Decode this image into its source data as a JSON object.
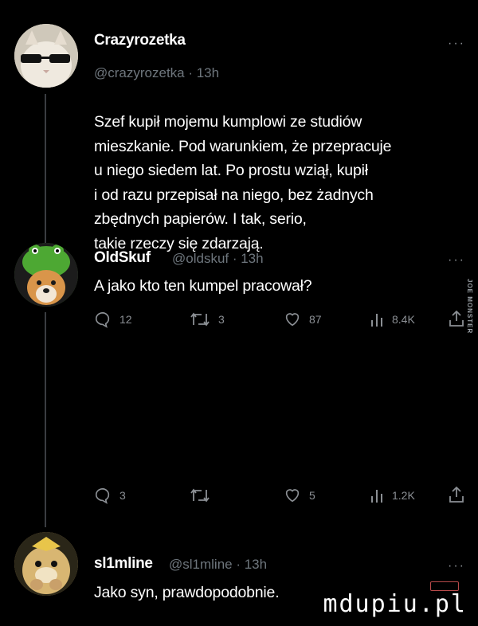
{
  "tweets": [
    {
      "name": "Crazyrozetka",
      "handle_time": "@crazyrozetka · 13h",
      "more": "···",
      "body": [
        "Szef kupił mojemu kumplowi ze studiów",
        "mieszkanie. Pod warunkiem, że przepracuje",
        "u niego siedem lat. Po prostu wziął, kupił",
        "i od razu przepisał na niego, bez żadnych",
        "zbędnych papierów. I tak, serio,",
        "takie rzeczy się zdarzają."
      ],
      "actions": {
        "replies": "12",
        "retweets": "3",
        "likes": "87",
        "views": "8.4K"
      }
    },
    {
      "name": "OldSkuf",
      "handle_time": "@oldskuf · 13h",
      "more": "···",
      "body": [
        "A jako kto ten kumpel pracował?"
      ],
      "actions": {
        "replies": "3",
        "retweets": "",
        "likes": "5",
        "views": "1.2K"
      }
    },
    {
      "name": "sl1mline",
      "handle_time": "@sl1mline · 13h",
      "more": "···",
      "body": [
        "Jako syn, prawdopodobnie."
      ]
    }
  ],
  "side_watermark": "JOE MONSTER",
  "watermark": "mdupiu.pl"
}
